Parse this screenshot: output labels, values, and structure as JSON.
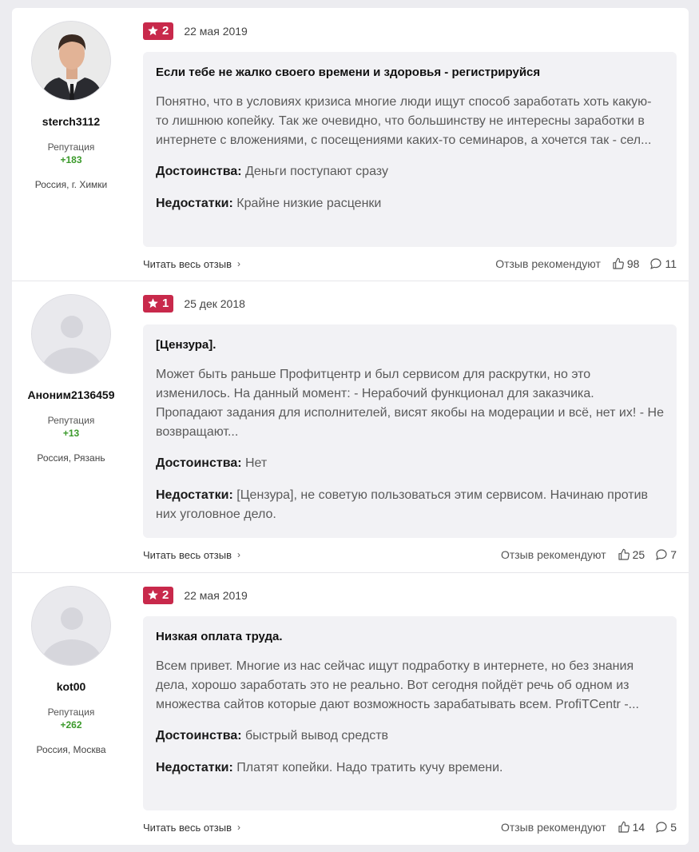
{
  "reviews": [
    {
      "author": {
        "name": "sterch3112",
        "rep_label": "Репутация",
        "rep_value": "+183",
        "location": "Россия, г. Химки",
        "avatar": "photo-avatar"
      },
      "rating": "2",
      "date": "22 мая 2019",
      "title": "Если тебе не жалко своего времени и здоровья - регистрируйся",
      "text": "Понятно, что в условиях кризиса многие люди ищут способ заработать хоть какую-то лишнюю копейку. Так же очевидно, что большинству не интересны заработки в интернете с вложениями, с посещениями каких-то семинаров, а хочется так - сел...",
      "pros_label": "Достоинства:",
      "pros": "Деньги поступают сразу",
      "cons_label": "Недостатки:",
      "cons": "Крайне низкие расценки",
      "read_more": "Читать весь отзыв",
      "recommend": "Отзыв рекомендуют",
      "likes": "98",
      "comments": "11"
    },
    {
      "author": {
        "name": "Аноним2136459",
        "rep_label": "Репутация",
        "rep_value": "+13",
        "location": "Россия, Рязань",
        "avatar": "default-avatar"
      },
      "rating": "1",
      "date": "25 дек 2018",
      "title": "[Цензура].",
      "text": "Может быть раньше Профитцентр и был сервисом для раскрутки, но это изменилось. На данный момент: - Нерабочий функционал для заказчика. Пропадают задания для исполнителей, висят якобы на модерации и всё, нет их! - Не возвращают...",
      "pros_label": "Достоинства:",
      "pros": "Нет",
      "cons_label": "Недостатки:",
      "cons": "[Цензура], не советую пользоваться этим сервисом. Начинаю против них уголовное дело.",
      "read_more": "Читать весь отзыв",
      "recommend": "Отзыв рекомендуют",
      "likes": "25",
      "comments": "7"
    },
    {
      "author": {
        "name": "kot00",
        "rep_label": "Репутация",
        "rep_value": "+262",
        "location": "Россия, Москва",
        "avatar": "default-avatar"
      },
      "rating": "2",
      "date": "22 мая 2019",
      "title": "Низкая оплата труда.",
      "text": "Всем привет. Многие из нас сейчас ищут подработку в интернете, но без знания дела, хорошо заработать это не реально. Вот сегодня пойдёт речь об одном из множества сайтов которые дают возможность зарабатывать всем. ProfiTCentr -...",
      "pros_label": "Достоинства:",
      "pros": "быстрый вывод средств",
      "cons_label": "Недостатки:",
      "cons": "Платят копейки. Надо тратить кучу времени.",
      "read_more": "Читать весь отзыв",
      "recommend": "Отзыв рекомендуют",
      "likes": "14",
      "comments": "5"
    }
  ],
  "colors": {
    "rating_bg": "#c8294b",
    "reputation": "#3b9a2b",
    "box_bg": "#f2f2f5"
  }
}
